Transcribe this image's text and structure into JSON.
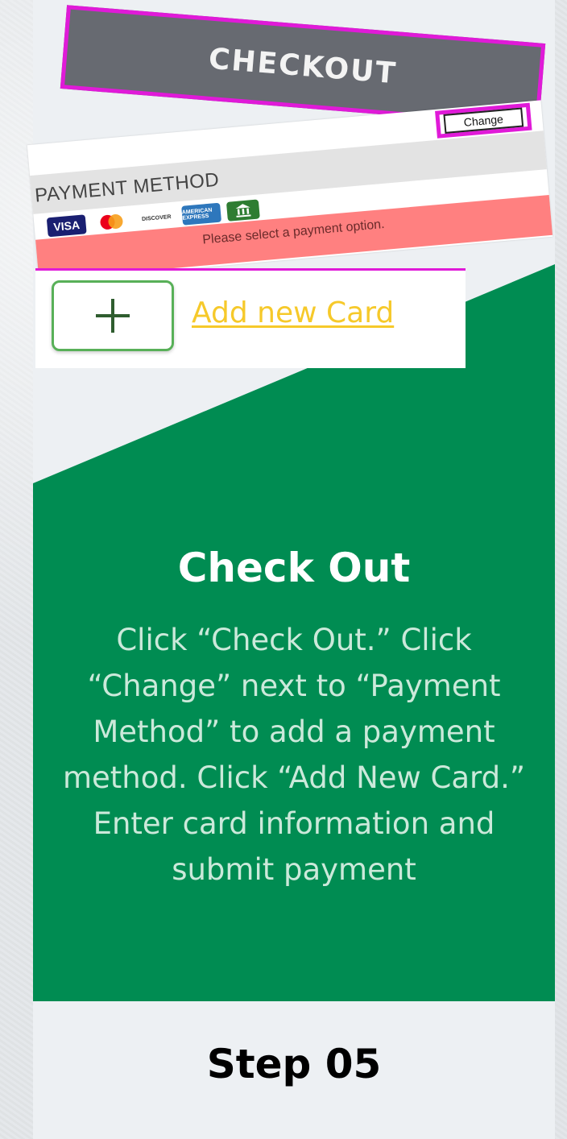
{
  "checkout_banner": {
    "label": "CHECKOUT"
  },
  "payment_panel": {
    "change_label": "Change",
    "title": "PAYMENT METHOD",
    "icons": {
      "visa": "VISA",
      "discover": "DISCOVER",
      "amex": "AMERICAN EXPRESS"
    },
    "error": "Please select a payment option."
  },
  "add_card": {
    "label": "Add new Card"
  },
  "step": {
    "title": "Check Out",
    "description": "Click “Check Out.” Click “Change” next to “Payment Method” to add a payment method. Click “Add New Card.” Enter card information and submit payment",
    "label": "Step 05"
  },
  "colors": {
    "green": "#008c52",
    "highlight": "#e01ad8",
    "link_yellow": "#f6c92a"
  }
}
